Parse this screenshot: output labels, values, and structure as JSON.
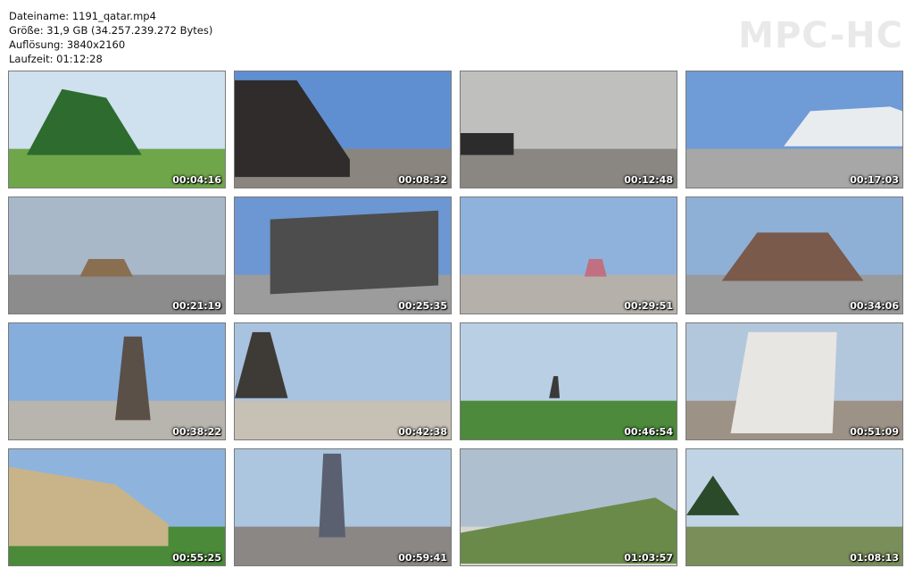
{
  "file_info": {
    "name_line": "Dateiname: 1191_qatar.mp4",
    "size_line": "Größe: 31,9 GB (34.257.239.272 Bytes)",
    "resolution_line": "Auflösung: 3840x2160",
    "duration_line": "Laufzeit: 01:12:28"
  },
  "logo_text": "MPC-HC",
  "thumbnails": [
    {
      "timestamp": "00:04:16",
      "sky": "#cfe0ee",
      "ground": "#6fa64a",
      "feature": "#2d6b2e"
    },
    {
      "timestamp": "00:08:32",
      "sky": "#5f8fd0",
      "ground": "#8a857e",
      "feature": "#2f2c2b"
    },
    {
      "timestamp": "00:12:48",
      "sky": "#bfbfbd",
      "ground": "#8a8682",
      "feature": "#2c2c2c"
    },
    {
      "timestamp": "00:17:03",
      "sky": "#6f9bd6",
      "ground": "#a7a7a7",
      "feature": "#e9ecef"
    },
    {
      "timestamp": "00:21:19",
      "sky": "#a8b8c8",
      "ground": "#8c8c8c",
      "feature": "#8a6e50"
    },
    {
      "timestamp": "00:25:35",
      "sky": "#6c97d2",
      "ground": "#9c9c9c",
      "feature": "#4d4d4d"
    },
    {
      "timestamp": "00:29:51",
      "sky": "#8fb2dc",
      "ground": "#b5b0aa",
      "feature": "#c07080"
    },
    {
      "timestamp": "00:34:06",
      "sky": "#8fb0d6",
      "ground": "#9a9a9a",
      "feature": "#7a5a4a"
    },
    {
      "timestamp": "00:38:22",
      "sky": "#85aedc",
      "ground": "#b8b4ae",
      "feature": "#5a5048"
    },
    {
      "timestamp": "00:42:38",
      "sky": "#a8c3df",
      "ground": "#c7c0b4",
      "feature": "#3e3a36"
    },
    {
      "timestamp": "00:46:54",
      "sky": "#b8cfe4",
      "ground": "#4d8a3b",
      "feature": "#3a3a3a"
    },
    {
      "timestamp": "00:51:09",
      "sky": "#b3c7dc",
      "ground": "#9d9286",
      "feature": "#e8e6e2"
    },
    {
      "timestamp": "00:55:25",
      "sky": "#8eb4de",
      "ground": "#4a8a38",
      "feature": "#c8b488"
    },
    {
      "timestamp": "00:59:41",
      "sky": "#adc6df",
      "ground": "#8a8784",
      "feature": "#5a6070"
    },
    {
      "timestamp": "01:03:57",
      "sky": "#aebfcf",
      "ground": "#d7d5d1",
      "feature": "#6a8a4a"
    },
    {
      "timestamp": "01:08:13",
      "sky": "#c0d4e6",
      "ground": "#7a8e5a",
      "feature": "#2a4a2a"
    }
  ]
}
